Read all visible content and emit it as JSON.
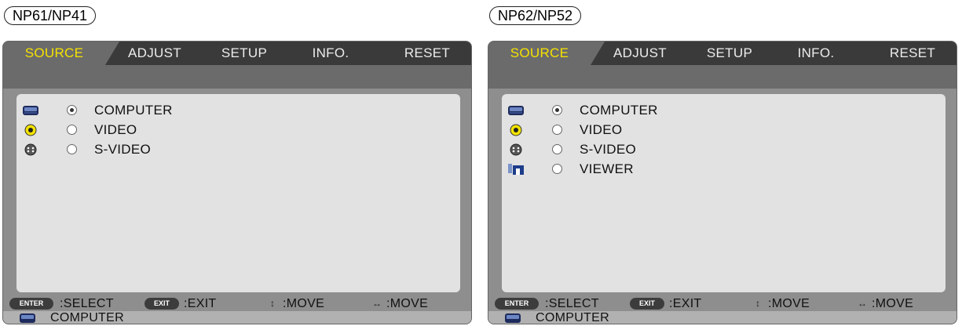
{
  "panels": [
    {
      "model": "NP61/NP41",
      "tabs": [
        "SOURCE",
        "ADJUST",
        "SETUP",
        "INFO.",
        "RESET"
      ],
      "active_tab": "SOURCE",
      "sources": [
        {
          "label": "COMPUTER",
          "icon": "computer-icon",
          "selected": true
        },
        {
          "label": "VIDEO",
          "icon": "video-icon",
          "selected": false
        },
        {
          "label": "S-VIDEO",
          "icon": "s-video-icon",
          "selected": false
        }
      ],
      "help": {
        "enter_key": "ENTER",
        "select": ":SELECT",
        "exit_key": "EXIT",
        "exit": ":EXIT",
        "updown_glyph": "↕",
        "move_v": ":MOVE",
        "leftright_glyph": "↔",
        "move_h": ":MOVE"
      },
      "status": {
        "icon": "computer-icon",
        "label": "COMPUTER"
      }
    },
    {
      "model": "NP62/NP52",
      "tabs": [
        "SOURCE",
        "ADJUST",
        "SETUP",
        "INFO.",
        "RESET"
      ],
      "active_tab": "SOURCE",
      "sources": [
        {
          "label": "COMPUTER",
          "icon": "computer-icon",
          "selected": true
        },
        {
          "label": "VIDEO",
          "icon": "video-icon",
          "selected": false
        },
        {
          "label": "S-VIDEO",
          "icon": "s-video-icon",
          "selected": false
        },
        {
          "label": "VIEWER",
          "icon": "viewer-icon",
          "selected": false
        }
      ],
      "help": {
        "enter_key": "ENTER",
        "select": ":SELECT",
        "exit_key": "EXIT",
        "exit": ":EXIT",
        "updown_glyph": "↕",
        "move_v": ":MOVE",
        "leftright_glyph": "↔",
        "move_h": ":MOVE"
      },
      "status": {
        "icon": "computer-icon",
        "label": "COMPUTER"
      }
    }
  ],
  "colors": {
    "active_tab_text": "#f5e200",
    "tab_bar": "#3a3a3a",
    "content_bg": "#e2e2e2",
    "frame_gray": "#8e8e8e"
  }
}
